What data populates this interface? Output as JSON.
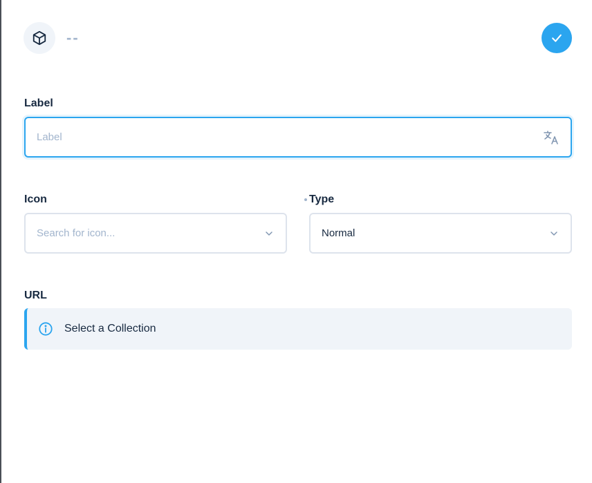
{
  "header": {
    "title": "--",
    "icon": "box-icon",
    "save_icon": "check-icon"
  },
  "fields": {
    "label": {
      "label": "Label",
      "placeholder": "Label",
      "translate_icon": "translate-icon"
    },
    "icon": {
      "label": "Icon",
      "placeholder": "Search for icon..."
    },
    "type": {
      "label": "Type",
      "value": "Normal",
      "required": true
    },
    "url": {
      "label": "URL",
      "notice": "Select a Collection",
      "notice_icon": "info-icon"
    }
  },
  "colors": {
    "accent": "#2ba5ef",
    "text": "#172940",
    "muted": "#a2b5cd",
    "border": "#dde3ec",
    "notice_bg": "#f0f4f9"
  }
}
